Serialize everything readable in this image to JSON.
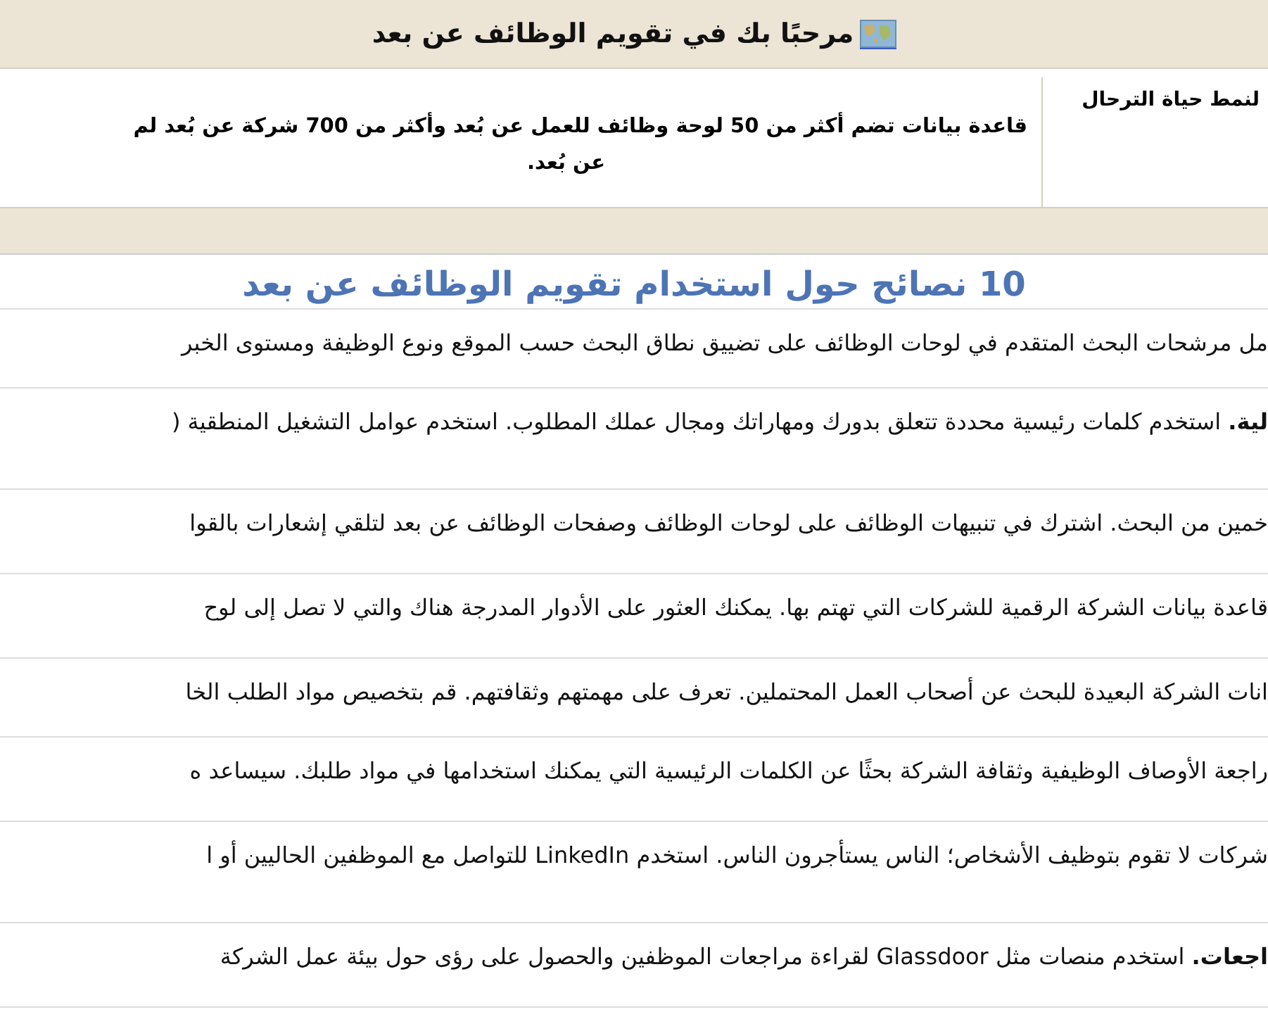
{
  "banner": {
    "title": "مرحبًا بك في تقويم الوظائف عن بعد"
  },
  "intro_row": {
    "label": "لنمط حياة الترحال",
    "lines": [
      "قاعدة بيانات تضم أكثر من 50 لوحة وظائف للعمل عن بُعد وأكثر من 700 شركة عن بُعد لم",
      "عن بُعد."
    ]
  },
  "tips": {
    "heading": "10 نصائح حول استخدام تقويم الوظائف عن بعد",
    "rows": [
      {
        "text": "مل مرشحات البحث المتقدم في لوحات الوظائف على تضييق نطاق البحث حسب الموقع ونوع الوظيفة ومستوى الخبر"
      },
      {
        "text": "**لية.** استخدم كلمات رئيسية محددة تتعلق بدورك ومهاراتك ومجال عملك المطلوب. استخدم عوامل التشغيل المنطقية ("
      },
      {
        "text": "خمين من البحث. اشترك في تنبيهات الوظائف على لوحات الوظائف وصفحات الوظائف عن بعد لتلقي إشعارات بالقوا"
      },
      {
        "text": "قاعدة بيانات الشركة الرقمية للشركات التي تهتم بها. يمكنك العثور على الأدوار المدرجة هناك والتي لا تصل إلى لوح"
      },
      {
        "text": "انات الشركة البعيدة للبحث عن أصحاب العمل المحتملين. تعرف على مهمتهم وثقافتهم. قم بتخصيص مواد الطلب الخا"
      },
      {
        "text": "راجعة الأوصاف الوظيفية وثقافة الشركة بحثًا عن الكلمات الرئيسية التي يمكنك استخدامها في مواد طلبك. سيساعد ه"
      },
      {
        "text": "شركات لا تقوم بتوظيف الأشخاص؛ الناس يستأجرون الناس. استخدم LinkedIn للتواصل مع الموظفين الحاليين أو ا"
      },
      {
        "text": "**اجعات.** استخدم منصات مثل Glassdoor لقراءة مراجعات الموظفين والحصول على رؤى حول بيئة عمل الشركة"
      }
    ]
  }
}
